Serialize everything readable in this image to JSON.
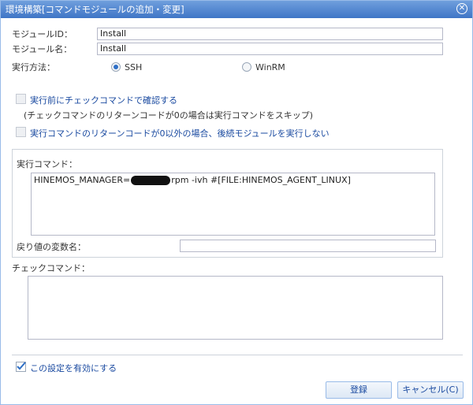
{
  "window": {
    "title": "環境構築[コマンドモジュールの追加・変更]",
    "close_glyph": "✕"
  },
  "form": {
    "module_id_label": "モジュールID：",
    "module_id_value": "Install",
    "module_name_label": "モジュール名：",
    "module_name_value": "Install",
    "exec_method_label": "実行方法：",
    "exec_methods": [
      {
        "label": "SSH",
        "selected": true
      },
      {
        "label": "WinRM",
        "selected": false
      }
    ],
    "precheck_label": "実行前にチェックコマンドで確認する",
    "precheck_note": "(チェックコマンドのリターンコードが0の場合は実行コマンドをスキップ)",
    "stop_on_error_label": "実行コマンドのリターンコードが0以外の場合、後続モジュールを実行しない",
    "exec_command_label": "実行コマンド：",
    "exec_command_prefix": "HINEMOS_MANAGER=",
    "exec_command_suffix": "rpm -ivh #[FILE:HINEMOS_AGENT_LINUX]",
    "return_var_label": "戻り値の変数名：",
    "return_var_value": "",
    "check_command_label": "チェックコマンド：",
    "check_command_value": "",
    "enable_label": "この設定を有効にする",
    "enable_checked": true
  },
  "buttons": {
    "register": "登録",
    "cancel": "キャンセル(C)"
  },
  "colors": {
    "title_bar": "#3f75c6",
    "accent": "#2e6fc6",
    "link": "#1a4aa0"
  },
  "icons": {
    "close": "close-icon",
    "check": "checkmark-icon"
  }
}
